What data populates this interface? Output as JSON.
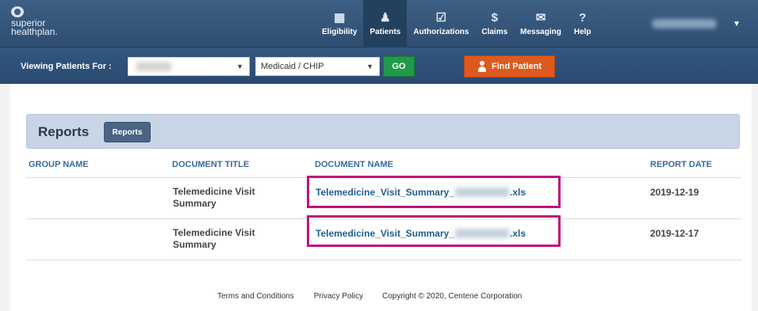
{
  "brand": {
    "line1": "superior",
    "line2": "healthplan."
  },
  "nav": [
    {
      "label": "Eligibility",
      "icon": "calendar-icon"
    },
    {
      "label": "Patients",
      "icon": "users-icon",
      "active": true
    },
    {
      "label": "Authorizations",
      "icon": "checkbox-icon"
    },
    {
      "label": "Claims",
      "icon": "dollar-icon"
    },
    {
      "label": "Messaging",
      "icon": "envelope-icon"
    },
    {
      "label": "Help",
      "icon": "question-icon"
    }
  ],
  "subbar": {
    "viewing_label": "Viewing Patients For :",
    "program_value": "Medicaid / CHIP",
    "go_label": "GO",
    "find_label": "Find Patient"
  },
  "reports": {
    "title": "Reports",
    "button": "Reports",
    "columns": {
      "group": "GROUP NAME",
      "doc_title": "DOCUMENT TITLE",
      "doc_name": "DOCUMENT NAME",
      "date": "REPORT DATE"
    },
    "rows": [
      {
        "group": "",
        "title": "Telemedicine Visit Summary",
        "name_prefix": "Telemedicine_Visit_Summary_",
        "name_suffix": ".xls",
        "date": "2019-12-19"
      },
      {
        "group": "",
        "title": "Telemedicine Visit Summary",
        "name_prefix": "Telemedicine_Visit_Summary_",
        "name_suffix": ".xls",
        "date": "2019-12-17"
      }
    ]
  },
  "footer": {
    "terms": "Terms and Conditions",
    "privacy": "Privacy Policy",
    "copyright": "Copyright © 2020, Centene Corporation"
  },
  "colors": {
    "nav_bg": "#2e4d72",
    "go": "#1f9a49",
    "find": "#dd5a1e",
    "highlight": "#c0137c",
    "link": "#1e5e8e"
  }
}
